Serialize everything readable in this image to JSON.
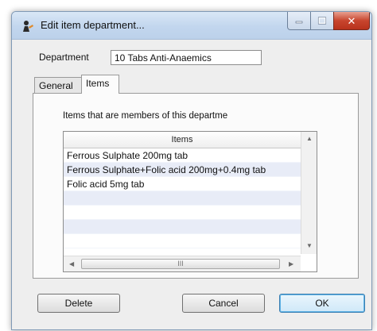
{
  "window": {
    "title": "Edit item department...",
    "icons": {
      "app": "app-figure-icon",
      "minimize": "minimize-icon",
      "maximize": "maximize-icon",
      "close": "close-icon"
    }
  },
  "department": {
    "label": "Department",
    "value": "10 Tabs Anti-Anaemics"
  },
  "tabs": [
    {
      "label": "General",
      "selected": false
    },
    {
      "label": "Items",
      "selected": true
    }
  ],
  "items_panel": {
    "caption": "Items that are members of this departme",
    "column_header": "Items",
    "rows": [
      "Ferrous Sulphate 200mg tab",
      "Ferrous Sulphate+Folic acid 200mg+0.4mg tab",
      "Folic acid 5mg tab",
      "",
      "",
      "",
      "",
      ""
    ],
    "scroll_thumb_grip": "III"
  },
  "buttons": {
    "delete": "Delete",
    "cancel": "Cancel",
    "ok": "OK"
  }
}
